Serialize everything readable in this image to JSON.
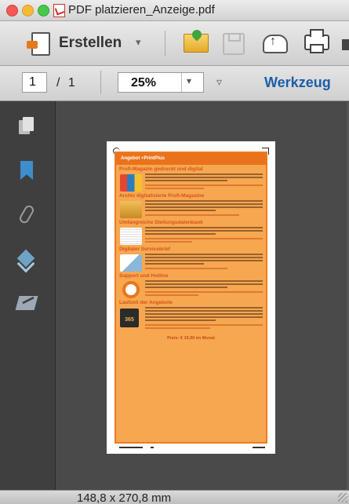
{
  "window": {
    "title": "PDF platzieren_Anzeige.pdf"
  },
  "toolbar": {
    "create_label": "Erstellen",
    "create_caret": "▾",
    "overflow_icon": "▿"
  },
  "nav": {
    "page_current": "1",
    "page_total": "/ 1",
    "zoom": "25%",
    "zoom_caret": "▾",
    "tools_label": "Werkzeug"
  },
  "sidebar": {
    "items": [
      "pages-icon",
      "bookmark-icon",
      "attachment-icon",
      "layers-icon",
      "signature-icon"
    ]
  },
  "document": {
    "header": "Angebot +PrintPlus",
    "sections": [
      {
        "title": "Profi-Magazin gedruckt und digital",
        "image": "magazine-stack"
      },
      {
        "title": "Archiv digitalisierte Profi-Magazine",
        "image": "archive-boxes"
      },
      {
        "title": "Umfangreiche Stellungsdatenbank",
        "image": "stack-of-papers"
      },
      {
        "title": "Digitaler Servicebrief",
        "image": "letters-stamp"
      },
      {
        "title": "Support und Hotline",
        "image": "lifebuoy"
      },
      {
        "title": "Laufzeit der Angebote",
        "image": "calendar-365"
      }
    ],
    "calendar_number": "365",
    "price": "Preis: € 19,90 im Monat"
  },
  "status": {
    "page_dimensions": "148,8 x 270,8 mm"
  },
  "colors": {
    "accent": "#1b5ea8",
    "ad_orange": "#f7a74f",
    "ad_header": "#e9731c"
  }
}
